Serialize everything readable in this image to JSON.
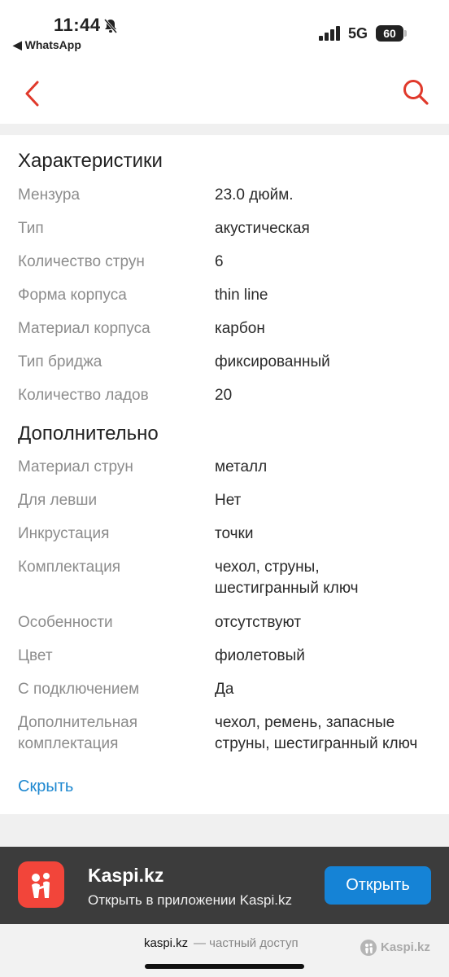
{
  "status_bar": {
    "time": "11:44",
    "back_app": "◀ WhatsApp",
    "network": "5G",
    "battery": "60"
  },
  "section_characteristics": {
    "title": "Характеристики",
    "rows": [
      {
        "label": "Мензура",
        "value": "23.0 дюйм."
      },
      {
        "label": "Тип",
        "value": "акустическая"
      },
      {
        "label": "Количество струн",
        "value": "6"
      },
      {
        "label": "Форма корпуса",
        "value": "thin line"
      },
      {
        "label": "Материал корпуса",
        "value": "карбон"
      },
      {
        "label": "Тип бриджа",
        "value": "фиксированный"
      },
      {
        "label": "Количество ладов",
        "value": "20"
      }
    ]
  },
  "section_additional": {
    "title": "Дополнительно",
    "rows": [
      {
        "label": "Материал струн",
        "value": "металл"
      },
      {
        "label": "Для левши",
        "value": "Нет"
      },
      {
        "label": "Инкрустация",
        "value": "точки"
      },
      {
        "label": "Комплектация",
        "value": "чехол, струны, шестигранный ключ"
      },
      {
        "label": "Особенности",
        "value": "отсутствуют"
      },
      {
        "label": "Цвет",
        "value": "фиолетовый"
      },
      {
        "label": "С подключением",
        "value": "Да"
      },
      {
        "label": "Дополнительная комплектация",
        "value": "чехол, ремень, запасные струны, шестигранный ключ"
      }
    ]
  },
  "hide_link": "Скрыть",
  "banner": {
    "title": "Kaspi.kz",
    "subtitle": "Открыть в приложении Kaspi.kz",
    "open_label": "Открыть"
  },
  "browser_bar": {
    "domain": "kaspi.kz",
    "note": "— частный доступ",
    "watermark": "Kaspi.kz"
  },
  "colors": {
    "accent_red": "#e0392b",
    "link_blue": "#1e88d0",
    "button_blue": "#1583d6",
    "banner_bg": "#3c3c3c"
  },
  "icons": [
    "bell-off-icon",
    "signal-icon",
    "back-chevron-icon",
    "search-icon",
    "kaspi-app-icon",
    "kaspi-logo-icon"
  ]
}
